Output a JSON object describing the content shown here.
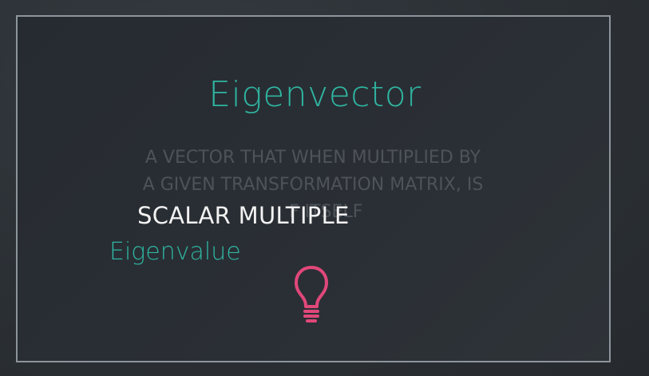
{
  "slide": {
    "title": "Eigenvector",
    "definition_lines": [
      "A VECTOR THAT WHEN MULTIPLIED BY",
      "A GIVEN TRANSFORMATION MATRIX, IS",
      "F ITSELF"
    ],
    "highlight": "SCALAR MULTIPLE",
    "term": "Eigenvalue",
    "icon": "lightbulb-icon"
  },
  "colors": {
    "background": "#2c3136",
    "border": "#8d959c",
    "accent_teal": "#2fb4a0",
    "bulb_pink": "#e0487a",
    "faded_text": "#4d5358",
    "highlight_text": "#f2f2f2"
  }
}
